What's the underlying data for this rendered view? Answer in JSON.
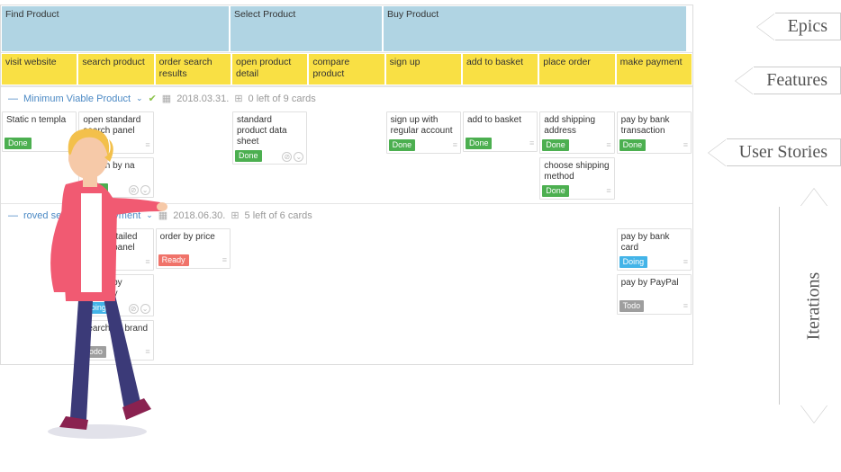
{
  "epics": [
    {
      "label": "Find Product",
      "span": 3
    },
    {
      "label": "Select Product",
      "span": 2
    },
    {
      "label": "Buy Product",
      "span": 4
    }
  ],
  "features": [
    "visit website",
    "search product",
    "order search results",
    "open product detail",
    "compare product",
    "sign up",
    "add to basket",
    "place order",
    "make payment"
  ],
  "iterations": [
    {
      "title": "Minimum Viable Product",
      "date": "2018.03.31.",
      "count": "0 left of 9 cards",
      "checked": true,
      "cols": [
        [
          {
            "t": "Static n templa",
            "s": "done"
          }
        ],
        [
          {
            "t": "open standard search panel",
            "s": "done",
            "icons": false
          },
          {
            "t": "search by na",
            "s": "done",
            "icons": true
          }
        ],
        [],
        [
          {
            "t": "standard product data sheet",
            "s": "done",
            "icons": true
          }
        ],
        [],
        [
          {
            "t": "sign up with regular account",
            "s": "done"
          }
        ],
        [
          {
            "t": "add to basket",
            "s": "done"
          }
        ],
        [
          {
            "t": "add shipping address",
            "s": "done"
          },
          {
            "t": "choose shipping method",
            "s": "done"
          }
        ],
        [
          {
            "t": "pay by bank transaction",
            "s": "done"
          }
        ]
      ]
    },
    {
      "title": "roved search and payment",
      "date": "2018.06.30.",
      "count": "5 left of 6 cards",
      "checked": false,
      "cols": [
        [],
        [
          {
            "t": "open detailed search panel",
            "s": "done"
          },
          {
            "t": "search by category",
            "s": "doing",
            "icons": true
          },
          {
            "t": "search by brand",
            "s": "todo"
          }
        ],
        [
          {
            "t": "order by price",
            "s": "ready"
          }
        ],
        [],
        [],
        [],
        [],
        [],
        [
          {
            "t": "pay by bank card",
            "s": "doing"
          },
          {
            "t": "pay by PayPal",
            "s": "todo"
          }
        ]
      ]
    }
  ],
  "labels": {
    "epics": "Epics",
    "features": "Features",
    "user_stories": "User Stories",
    "iterations": "Iterations"
  },
  "status_labels": {
    "done": "Done",
    "ready": "Ready",
    "doing": "Doing",
    "todo": "Todo"
  }
}
